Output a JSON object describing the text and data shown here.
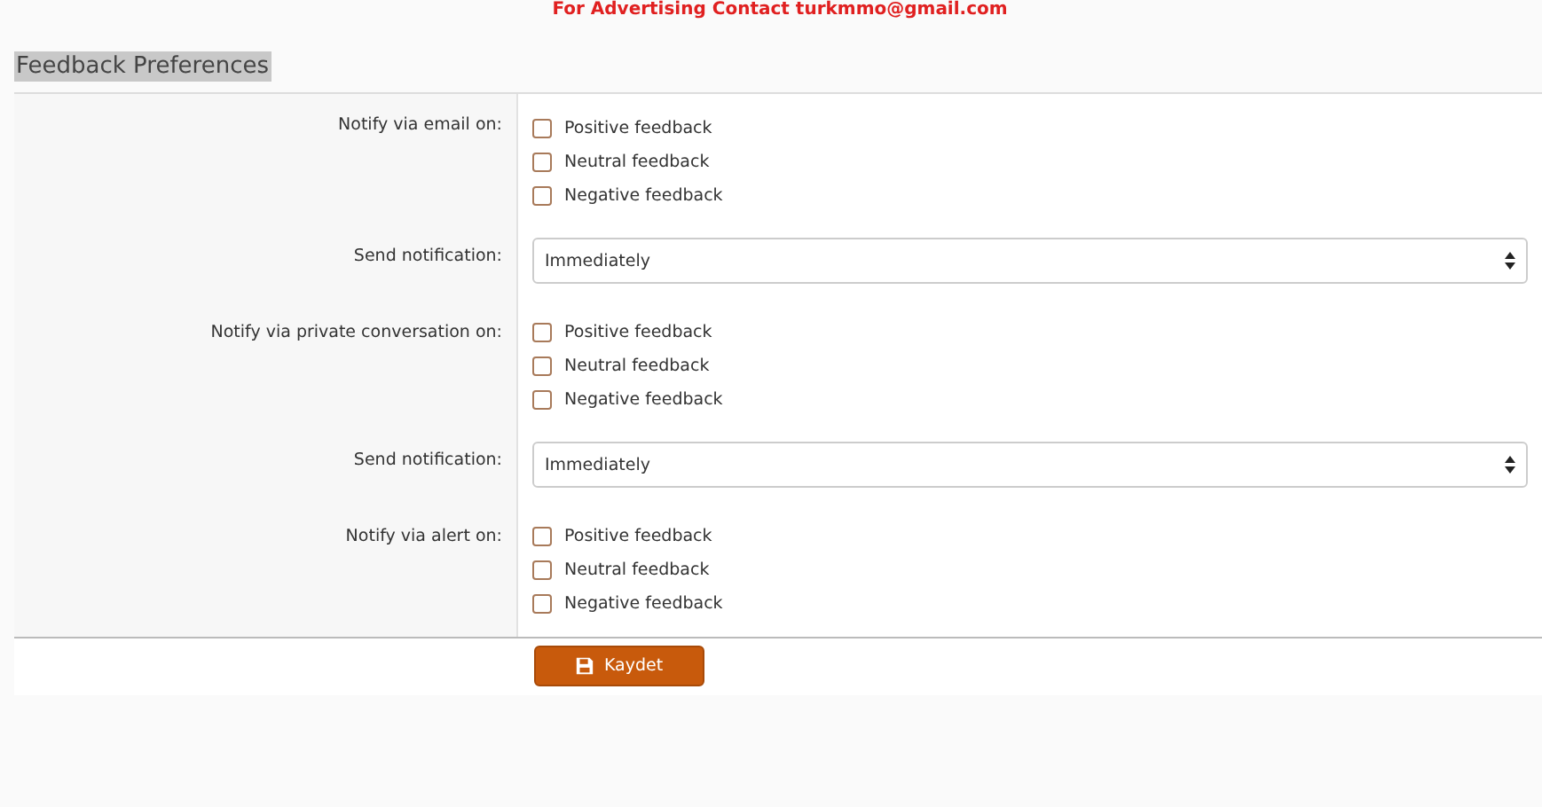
{
  "notice": "For Advertising Contact turkmmo@gmail.com",
  "section_title": "Feedback Preferences",
  "rows": [
    {
      "kind": "checkboxes",
      "label": "Notify via email on:",
      "options": [
        {
          "label": "Positive feedback",
          "checked": false
        },
        {
          "label": "Neutral feedback",
          "checked": false
        },
        {
          "label": "Negative feedback",
          "checked": false
        }
      ]
    },
    {
      "kind": "select",
      "label": "Send notification:",
      "value": "Immediately"
    },
    {
      "kind": "checkboxes",
      "label": "Notify via private conversation on:",
      "options": [
        {
          "label": "Positive feedback",
          "checked": false
        },
        {
          "label": "Neutral feedback",
          "checked": false
        },
        {
          "label": "Negative feedback",
          "checked": false
        }
      ]
    },
    {
      "kind": "select",
      "label": "Send notification:",
      "value": "Immediately"
    },
    {
      "kind": "checkboxes",
      "label": "Notify via alert on:",
      "options": [
        {
          "label": "Positive feedback",
          "checked": false
        },
        {
          "label": "Neutral feedback",
          "checked": false
        },
        {
          "label": "Negative feedback",
          "checked": false
        }
      ]
    }
  ],
  "save_button": "Kaydet"
}
